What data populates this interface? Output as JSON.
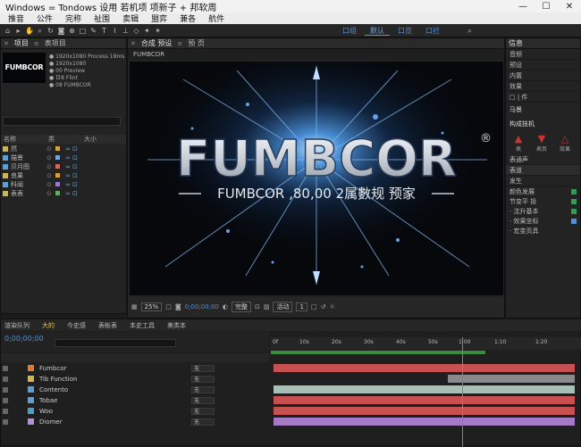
{
  "window": {
    "title": "Windows = Tondows  设用 若机项 项新子 + 邦软周",
    "min": "—",
    "max": "☐",
    "close": "✕"
  },
  "menu": [
    "推音",
    "公件",
    "完称",
    "祉围",
    "卖辑",
    "盟弈",
    "兼各",
    "航件"
  ],
  "workspaces": [
    {
      "label": "口组",
      "active": false
    },
    {
      "label": "默认",
      "active": true
    },
    {
      "label": "口览",
      "active": false
    },
    {
      "label": "口拦",
      "active": false
    }
  ],
  "project": {
    "tabs": [
      "项目",
      "表项目"
    ],
    "thumb_text": "FUMBCOR",
    "info": [
      "● 1920x1080 Process 18ms",
      "● 1920x1080",
      "● 00 Preview",
      "● 日8 Flint",
      "● 08 FUMBCOR"
    ],
    "header": [
      "名称",
      "类",
      "大小"
    ],
    "rows": [
      {
        "name": "然",
        "color": "#c7b74e",
        "label": "#d4a23c"
      },
      {
        "name": "描景",
        "color": "#5aa0d8",
        "label": "#7aa6d6"
      },
      {
        "name": "贝月图",
        "color": "#5aa0d8",
        "label": "#cf6a6a"
      },
      {
        "name": "良果",
        "color": "#c7b74e",
        "label": "#d4a23c"
      },
      {
        "name": "科闻",
        "color": "#5aa0d8",
        "label": "#9a7acc"
      },
      {
        "name": "表表",
        "color": "#c7b74e",
        "label": "#6aa86a"
      }
    ]
  },
  "composition": {
    "tabs": [
      "合成 预设",
      "预 页"
    ],
    "subtitle": "FUMBCOR",
    "title": "FUMBCOR",
    "registered": "®",
    "tagline": "FUMBCOR ,80,00 2属數规 预家",
    "bottom": [
      "25%",
      "□",
      "0;00;00;00",
      "完整",
      "活动",
      "1",
      "□"
    ]
  },
  "effects": {
    "tabs": [
      "信息",
      "音频"
    ],
    "rows": [
      "预设",
      "内置",
      "效果",
      "□ | 件"
    ],
    "section1": "马景",
    "section2": "构成技机",
    "icons": [
      {
        "glyph": "▲",
        "label": "表"
      },
      {
        "glyph": "▼",
        "label": "表页"
      },
      {
        "glyph": "△",
        "label": "效果"
      }
    ],
    "items": [
      {
        "label": "表通声",
        "color": ""
      },
      {
        "label": "表道",
        "color": ""
      },
      {
        "label": "发生",
        "color": ""
      }
    ],
    "checks": [
      {
        "label": "颜色发展",
        "color": "#2e9d56"
      },
      {
        "label": "节变平 投",
        "color": "#2e9d56"
      },
      {
        "label": "· 沈升基本",
        "color": "#2e9d56"
      },
      {
        "label": "· 效果坐标",
        "color": "#4f8fd6"
      },
      {
        "label": "· 宏变页具",
        "color": ""
      }
    ]
  },
  "timeline": {
    "tabs": [
      {
        "label": "渲染队列",
        "on": false
      },
      {
        "label": "大的",
        "on": true
      },
      {
        "label": "今史感",
        "on": false
      },
      {
        "label": "表帐表",
        "on": false
      },
      {
        "label": "本史工具",
        "on": false
      },
      {
        "label": "美类本",
        "on": false
      }
    ],
    "time": "0;00;00;00",
    "ruler": [
      "0f",
      "10s",
      "20s",
      "30s",
      "40s",
      "50s",
      "1:00",
      "1:10",
      "1:20"
    ],
    "layers": [
      {
        "name": "Fumbcor",
        "color": "#e07b2a",
        "sel": "无"
      },
      {
        "name": "Tib Function",
        "color": "#d8b54a",
        "sel": "无"
      },
      {
        "name": "Contento",
        "color": "#5aa0d8",
        "sel": "无"
      },
      {
        "name": "Tobae",
        "color": "#5aa0d8",
        "sel": "无"
      },
      {
        "name": "Woo",
        "color": "#4aa0c8",
        "sel": "无"
      },
      {
        "name": "Diomer",
        "color": "#b28fd8",
        "sel": "无"
      }
    ],
    "bars": [
      "#c65150",
      "#b8b8b8",
      "#a8bfb8",
      "#c65150",
      "#c65150",
      "#a47ac8"
    ]
  }
}
